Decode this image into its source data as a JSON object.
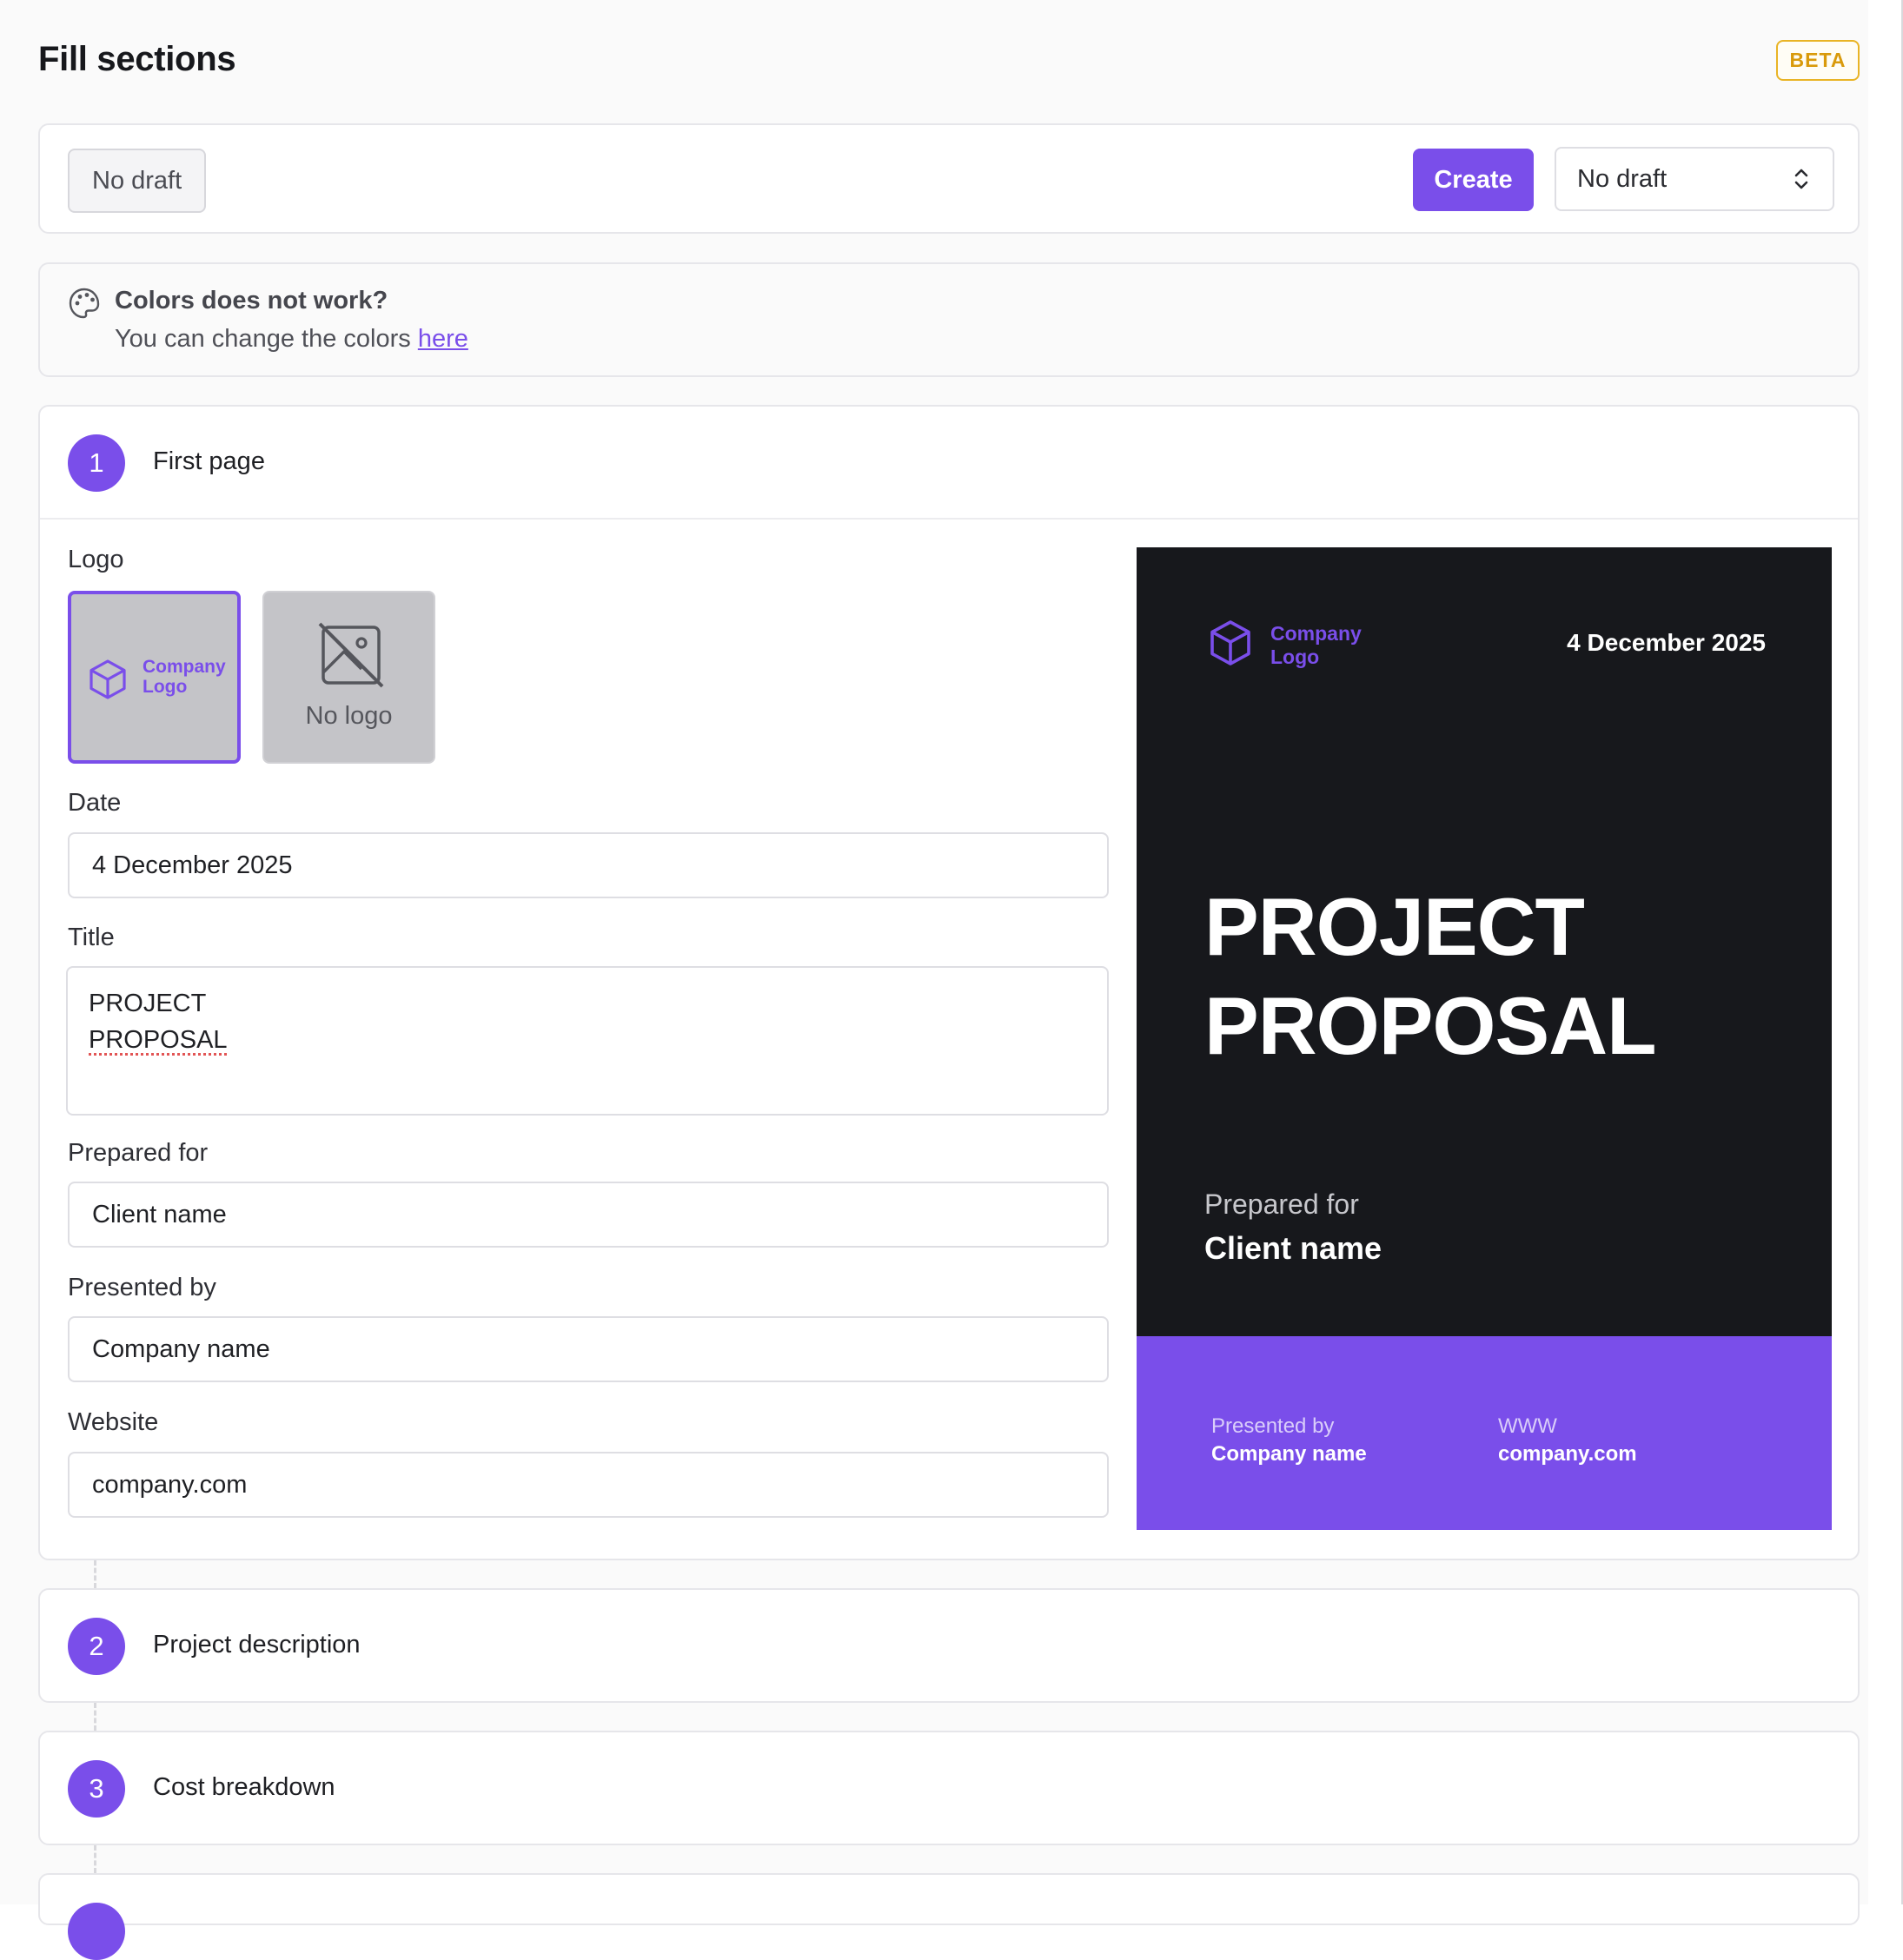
{
  "header": {
    "title": "Fill sections",
    "badge": "BETA"
  },
  "draft": {
    "current_label": "No draft",
    "create_label": "Create",
    "select_value": "No draft"
  },
  "colors_notice": {
    "title": "Colors does not work?",
    "text": "You can change the colors",
    "link": "here"
  },
  "sections": [
    {
      "number": "1",
      "label": "First page"
    },
    {
      "number": "2",
      "label": "Project description"
    },
    {
      "number": "3",
      "label": "Cost breakdown"
    }
  ],
  "form": {
    "logo_label": "Logo",
    "logo_options": {
      "company_logo_line1": "Company",
      "company_logo_line2": "Logo",
      "no_logo": "No logo"
    },
    "date_label": "Date",
    "date_value": "4 December 2025",
    "title_label": "Title",
    "title_line1": "PROJECT",
    "title_line2": "PROPOSAL",
    "prepared_for_label": "Prepared for",
    "prepared_for_value": "Client name",
    "presented_by_label": "Presented by",
    "presented_by_value": "Company name",
    "website_label": "Website",
    "website_value": "company.com"
  },
  "preview": {
    "logo_line1": "Company",
    "logo_line2": "Logo",
    "date": "4 December 2025",
    "title_line1": "PROJECT",
    "title_line2": "PROPOSAL",
    "prepared_for_label": "Prepared for",
    "prepared_for_value": "Client name",
    "presented_by_label": "Presented by",
    "presented_by_value": "Company name",
    "website_label": "WWW",
    "website_value": "company.com"
  },
  "colors": {
    "accent": "#7a4eea",
    "preview_bg": "#17181c",
    "badge": "#e9b425"
  }
}
